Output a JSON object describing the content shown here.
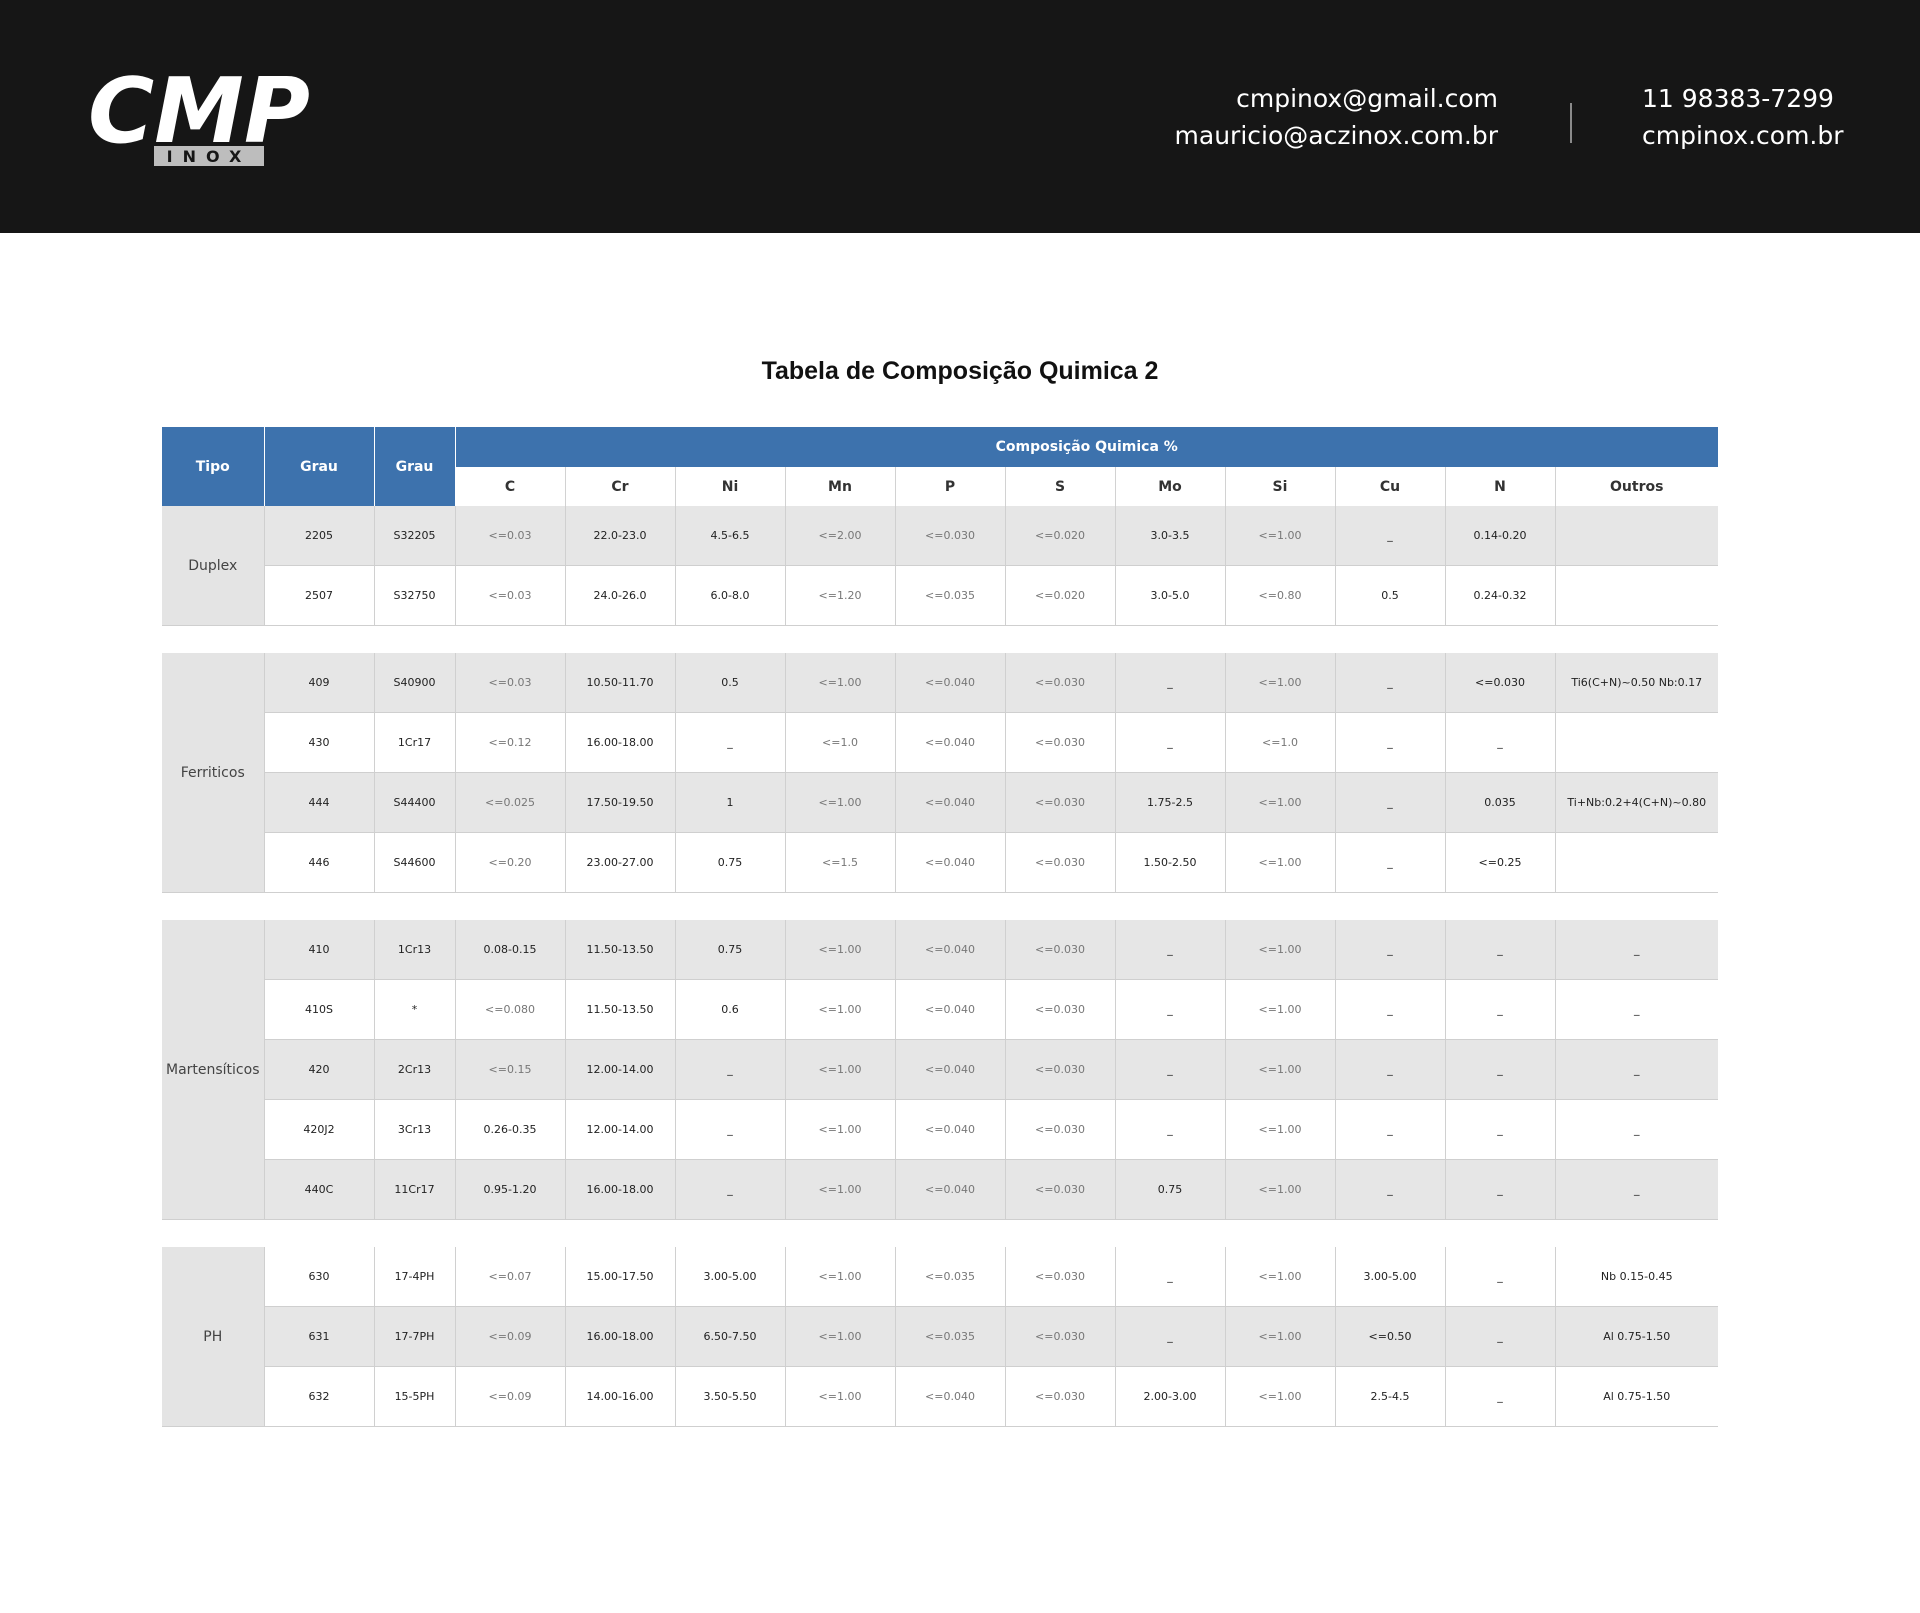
{
  "header": {
    "logo_main": "CMP",
    "logo_sub": "INOX",
    "emails": [
      "cmpinox@gmail.com",
      "mauricio@aczinox.com.br"
    ],
    "contacts": [
      "11 98383-7299",
      "cmpinox.com.br"
    ]
  },
  "title": "Tabela de Composição Quimica 2",
  "table": {
    "headers": {
      "tipo": "Tipo",
      "grau1": "Grau",
      "grau2": "Grau",
      "composicao": "Composição Quimica %",
      "elements": [
        "C",
        "Cr",
        "Ni",
        "Mn",
        "P",
        "S",
        "Mo",
        "Si",
        "Cu",
        "N",
        "Outros"
      ]
    },
    "groups": [
      {
        "tipo": "Duplex",
        "rows": [
          [
            "2205",
            "S32205",
            "<=0.03",
            "22.0-23.0",
            "4.5-6.5",
            "<=2.00",
            "<=0.030",
            "<=0.020",
            "3.0-3.5",
            "<=1.00",
            "_",
            "0.14-0.20",
            ""
          ],
          [
            "2507",
            "S32750",
            "<=0.03",
            "24.0-26.0",
            "6.0-8.0",
            "<=1.20",
            "<=0.035",
            "<=0.020",
            "3.0-5.0",
            "<=0.80",
            "0.5",
            "0.24-0.32",
            ""
          ]
        ]
      },
      {
        "tipo": "Ferriticos",
        "rows": [
          [
            "409",
            "S40900",
            "<=0.03",
            "10.50-11.70",
            "0.5",
            "<=1.00",
            "<=0.040",
            "<=0.030",
            "_",
            "<=1.00",
            "_",
            "<=0.030",
            "Ti6(C+N)~0.50  Nb:0.17"
          ],
          [
            "430",
            "1Cr17",
            "<=0.12",
            "16.00-18.00",
            "_",
            "<=1.0",
            "<=0.040",
            "<=0.030",
            "_",
            "<=1.0",
            "_",
            "_",
            ""
          ],
          [
            "444",
            "S44400",
            "<=0.025",
            "17.50-19.50",
            "1",
            "<=1.00",
            "<=0.040",
            "<=0.030",
            "1.75-2.5",
            "<=1.00",
            "_",
            "0.035",
            "Ti+Nb:0.2+4(C+N)~0.80"
          ],
          [
            "446",
            "S44600",
            "<=0.20",
            "23.00-27.00",
            "0.75",
            "<=1.5",
            "<=0.040",
            "<=0.030",
            "1.50-2.50",
            "<=1.00",
            "_",
            "<=0.25",
            ""
          ]
        ]
      },
      {
        "tipo": "Martensíticos",
        "rows": [
          [
            "410",
            "1Cr13",
            "0.08-0.15",
            "11.50-13.50",
            "0.75",
            "<=1.00",
            "<=0.040",
            "<=0.030",
            "_",
            "<=1.00",
            "_",
            "_",
            "_"
          ],
          [
            "410S",
            "*",
            "<=0.080",
            "11.50-13.50",
            "0.6",
            "<=1.00",
            "<=0.040",
            "<=0.030",
            "_",
            "<=1.00",
            "_",
            "_",
            "_"
          ],
          [
            "420",
            "2Cr13",
            "<=0.15",
            "12.00-14.00",
            "_",
            "<=1.00",
            "<=0.040",
            "<=0.030",
            "_",
            "<=1.00",
            "_",
            "_",
            "_"
          ],
          [
            "420J2",
            "3Cr13",
            "0.26-0.35",
            "12.00-14.00",
            "_",
            "<=1.00",
            "<=0.040",
            "<=0.030",
            "_",
            "<=1.00",
            "_",
            "_",
            "_"
          ],
          [
            "440C",
            "11Cr17",
            "0.95-1.20",
            "16.00-18.00",
            "_",
            "<=1.00",
            "<=0.040",
            "<=0.030",
            "0.75",
            "<=1.00",
            "_",
            "_",
            "_"
          ]
        ]
      },
      {
        "tipo": "PH",
        "rows": [
          [
            "630",
            "17-4PH",
            "<=0.07",
            "15.00-17.50",
            "3.00-5.00",
            "<=1.00",
            "<=0.035",
            "<=0.030",
            "_",
            "<=1.00",
            "3.00-5.00",
            "_",
            "Nb 0.15-0.45"
          ],
          [
            "631",
            "17-7PH",
            "<=0.09",
            "16.00-18.00",
            "6.50-7.50",
            "<=1.00",
            "<=0.035",
            "<=0.030",
            "_",
            "<=1.00",
            "<=0.50",
            "_",
            "Al 0.75-1.50"
          ],
          [
            "632",
            "15-5PH",
            "<=0.09",
            "14.00-16.00",
            "3.50-5.50",
            "<=1.00",
            "<=0.040",
            "<=0.030",
            "2.00-3.00",
            "<=1.00",
            "2.5-4.5",
            "_",
            "Al 0.75-1.50"
          ]
        ]
      }
    ]
  }
}
